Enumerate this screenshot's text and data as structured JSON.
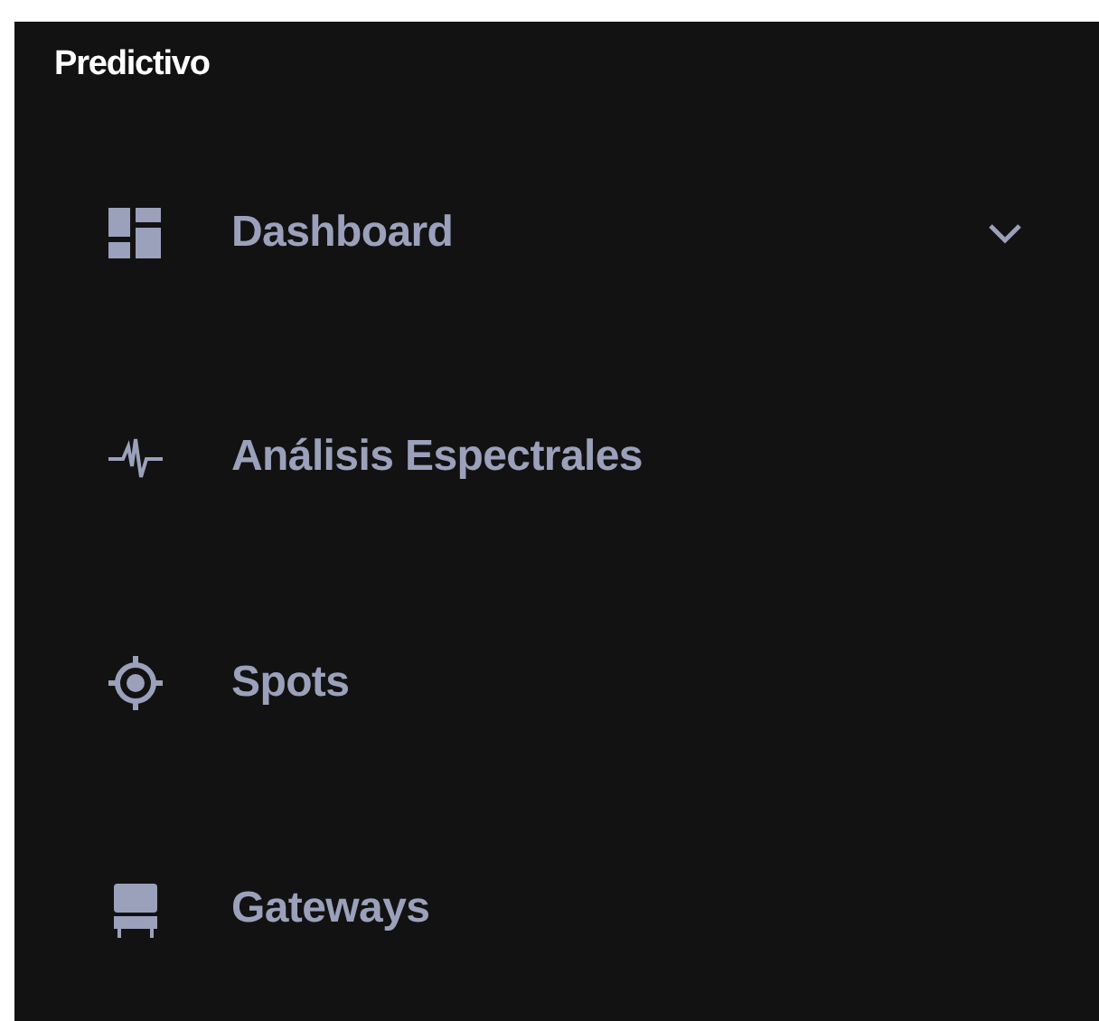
{
  "sidebar": {
    "title": "Predictivo",
    "items": [
      {
        "label": "Dashboard",
        "expanded": false
      },
      {
        "label": "Análisis Espectrales"
      },
      {
        "label": "Spots"
      },
      {
        "label": "Gateways"
      }
    ]
  }
}
